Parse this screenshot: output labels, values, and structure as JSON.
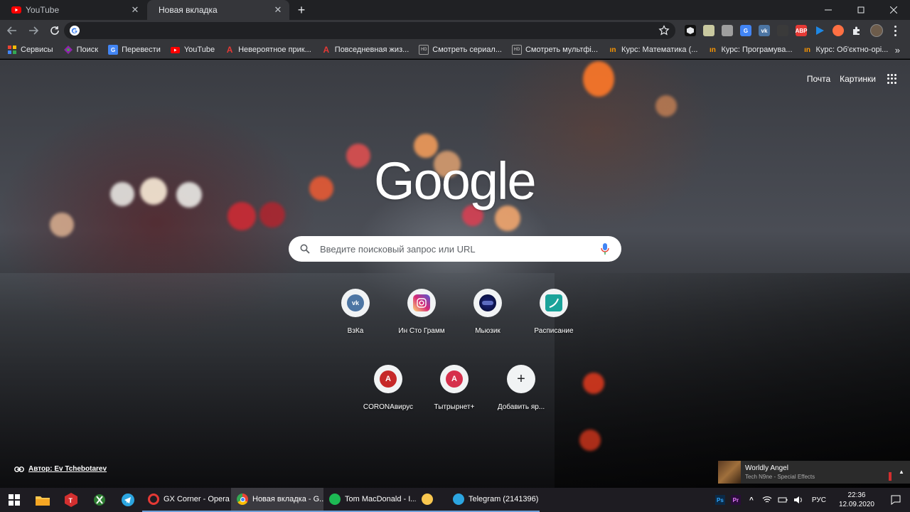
{
  "tabs": [
    {
      "title": "YouTube",
      "favicon": "youtube-icon",
      "active": false
    },
    {
      "title": "Новая вкладка",
      "favicon": "none",
      "active": true
    }
  ],
  "toolbar": {
    "omnibox_value": "",
    "extensions": [
      "box-icon",
      "qr-icon",
      "puzzle-gray-icon",
      "translate-icon",
      "vk-icon",
      "shield-icon",
      "adblock-icon",
      "play-icon",
      "globe-icon",
      "extensions-puzzle-icon"
    ],
    "adblock_label": "ABP"
  },
  "bookmarks": [
    {
      "label": "Сервисы",
      "icon": "apps-icon"
    },
    {
      "label": "Поиск",
      "icon": "search-colorful-icon"
    },
    {
      "label": "Перевести",
      "icon": "translate-icon"
    },
    {
      "label": "YouTube",
      "icon": "youtube-icon"
    },
    {
      "label": "Невероятное прик...",
      "icon": "letter-a-icon"
    },
    {
      "label": "Повседневная жиз...",
      "icon": "letter-a-icon"
    },
    {
      "label": "Смотреть сериал...",
      "icon": "hd-icon"
    },
    {
      "label": "Смотреть мультфі...",
      "icon": "hd-icon"
    },
    {
      "label": "Курс: Математика (...",
      "icon": "prometheus-icon"
    },
    {
      "label": "Курс: Програмува...",
      "icon": "prometheus-icon"
    },
    {
      "label": "Курс: Об'єктно-орі...",
      "icon": "prometheus-icon"
    }
  ],
  "bookmark_badge": {
    "hd": "HD",
    "letter": "A",
    "prometheus": "ın"
  },
  "ntp": {
    "top_links": {
      "mail": "Почта",
      "images": "Картинки"
    },
    "logo": "Google",
    "search_placeholder": "Введите поисковый запрос или URL",
    "shortcuts": [
      {
        "label": "ВзКа",
        "icon": "vk-icon",
        "glyph": "vk"
      },
      {
        "label": "Ин Сто Грамм",
        "icon": "instagram-icon",
        "glyph": ""
      },
      {
        "label": "Мьюзик",
        "icon": "music-icon",
        "glyph": ""
      },
      {
        "label": "Расписание",
        "icon": "schedule-icon",
        "glyph": ""
      },
      {
        "label": "CORONAвирус",
        "icon": "letter-a-icon",
        "glyph": "A"
      },
      {
        "label": "Тытрырнет+",
        "icon": "letter-a-icon",
        "glyph": "A"
      },
      {
        "label": "Добавить яр...",
        "icon": "plus-icon",
        "glyph": "+"
      }
    ],
    "author": "Автор: Ev Tchebotarev"
  },
  "media": {
    "title": "Worldly Angel",
    "subtitle": "Tech N9ne - Special Effects"
  },
  "taskbar": {
    "apps": [
      {
        "label": "GX Corner - Opera",
        "icon": "opera-icon",
        "active": false
      },
      {
        "label": "Новая вкладка - G...",
        "icon": "chrome-icon",
        "active": true
      },
      {
        "label": "Tom MacDonald - I...",
        "icon": "spotify-icon",
        "active": false
      },
      {
        "label": "",
        "icon": "warning-icon",
        "active": false
      },
      {
        "label": "Telegram (2141396)",
        "icon": "telegram-icon",
        "active": false
      }
    ],
    "tray": {
      "ps": "Ps",
      "pr": "Pr",
      "lang": "РУС",
      "time": "22:36",
      "date": "12.09.2020"
    }
  },
  "colors": {
    "accent": "#6f9fd8",
    "youtube": "#ff0000",
    "vk": "#4c75a3",
    "tile_red": "#c62828"
  }
}
